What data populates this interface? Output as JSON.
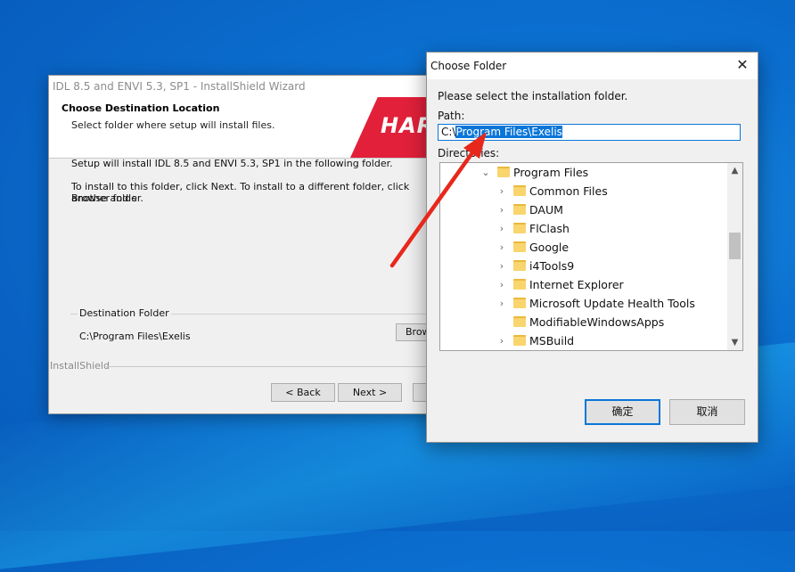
{
  "installer": {
    "title": "IDL 8.5 and ENVI 5.3, SP1 - InstallShield Wizard",
    "header_title": "Choose Destination Location",
    "header_subtitle": "Select folder where setup will install files.",
    "brand_text": "HAR",
    "body_line1": "Setup will install IDL 8.5 and ENVI 5.3, SP1 in the following folder.",
    "body_line2a": "To install to this folder, click Next. To install to a different folder, click Browse and s",
    "body_line2b": "another folder.",
    "dest_legend": "Destination Folder",
    "dest_path": "C:\\Program Files\\Exelis",
    "browse_label": "Brow",
    "installshield_label": "InstallShield",
    "back_label": "< Back",
    "next_label": "Next >"
  },
  "dialog": {
    "title": "Choose Folder",
    "close_glyph": "✕",
    "prompt": "Please select the installation folder.",
    "path_label": "Path:",
    "path_prefix": "C:\\",
    "path_selected": "Program Files\\Exelis",
    "directories_label": "Directories:",
    "tree": [
      {
        "label": "Program Files",
        "expanded": true
      },
      {
        "label": "Common Files"
      },
      {
        "label": "DAUM"
      },
      {
        "label": "FlClash"
      },
      {
        "label": "Google"
      },
      {
        "label": "i4Tools9"
      },
      {
        "label": "Internet Explorer"
      },
      {
        "label": "Microsoft Update Health Tools"
      },
      {
        "label": "ModifiableWindowsApps"
      },
      {
        "label": "MSBuild"
      }
    ],
    "ok_label": "确定",
    "cancel_label": "取消"
  },
  "annotation": {
    "arrow_color": "#e8271c"
  }
}
